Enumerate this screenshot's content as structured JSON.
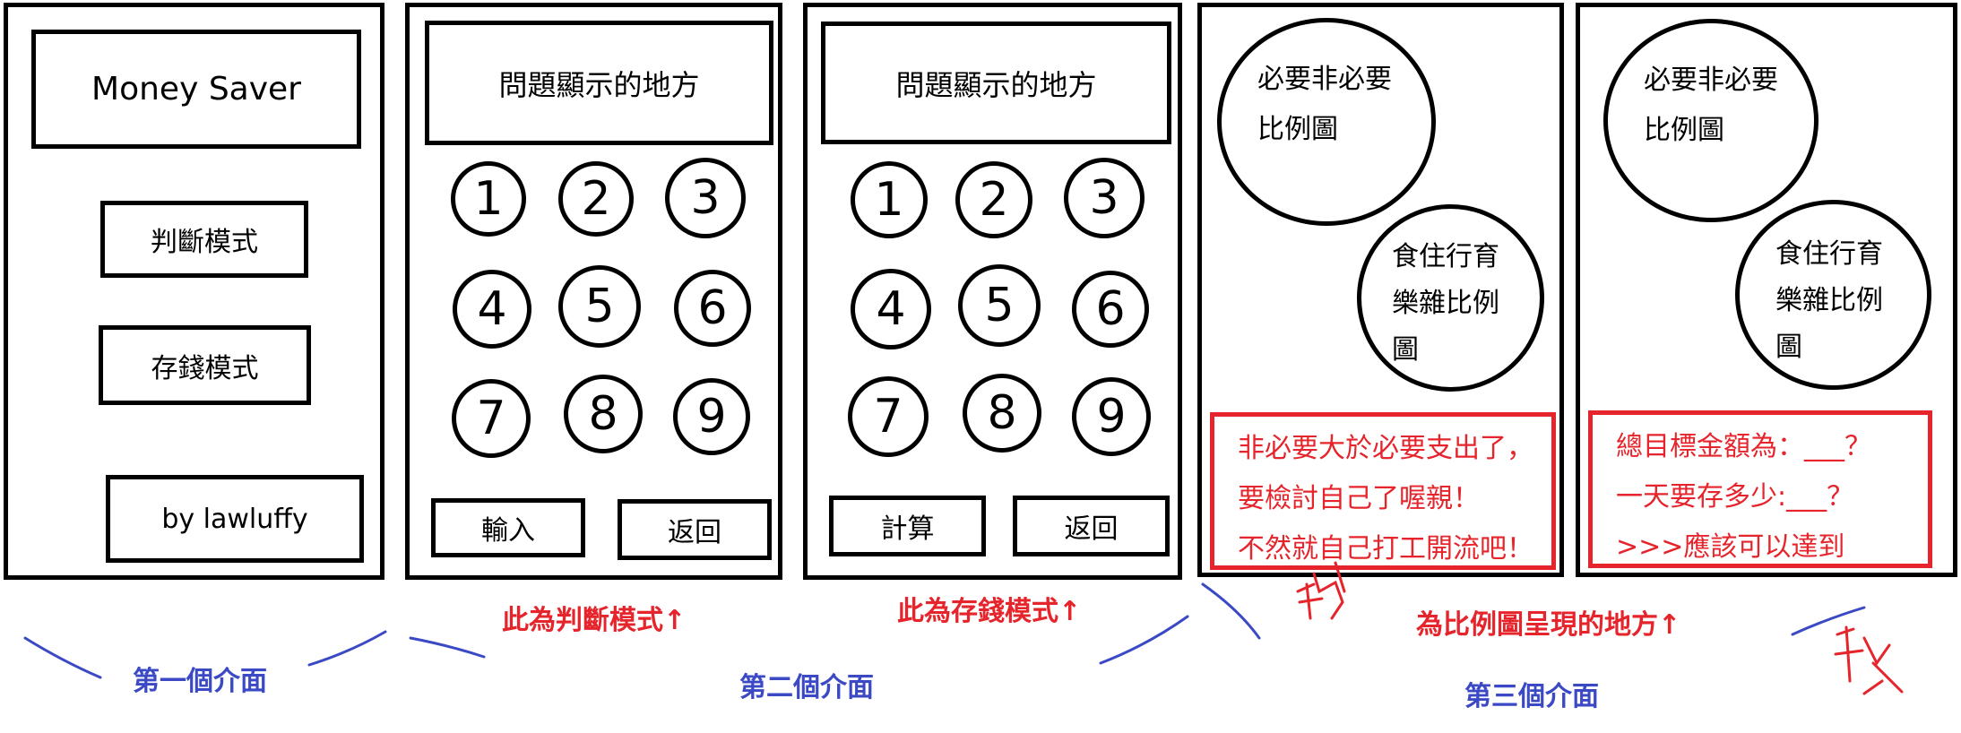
{
  "screen1": {
    "app_title": "Money Saver",
    "judge_mode_button": "判斷模式",
    "save_mode_button": "存錢模式",
    "author": "by lawluffy"
  },
  "screen2": {
    "question_area": "問題顯示的地方",
    "keys": [
      "1",
      "2",
      "3",
      "4",
      "5",
      "6",
      "7",
      "8",
      "9"
    ],
    "input_button": "輸入",
    "back_button": "返回"
  },
  "screen3": {
    "question_area": "問題顯示的地方",
    "keys": [
      "1",
      "2",
      "3",
      "4",
      "5",
      "6",
      "7",
      "8",
      "9"
    ],
    "calc_button": "計算",
    "back_button": "返回"
  },
  "screen4": {
    "chart1": [
      "必要非必要",
      "比例圖"
    ],
    "chart2": [
      "食住行育",
      "樂雜比例",
      "圖"
    ],
    "message": [
      "非必要大於必要支出了，",
      "要檢討自己了喔親！",
      "不然就自己打工開流吧！"
    ]
  },
  "screen5": {
    "chart1": [
      "必要非必要",
      "比例圖"
    ],
    "chart2": [
      "食住行育",
      "樂雜比例",
      "圖"
    ],
    "message": [
      "總目標金額為：___？",
      "一天要存多少:___？",
      ">>>應該可以達到"
    ]
  },
  "annotations": {
    "first_interface": "第一個介面",
    "second_interface": "第二個介面",
    "third_interface": "第三個介面",
    "judge_mode_note": "此為判斷模式↑",
    "save_mode_note": "此為存錢模式↑",
    "chart_note": "為比例圖呈現的地方↑"
  },
  "colors": {
    "annotation_red": "#e5242b",
    "annotation_blue": "#3b49c4"
  }
}
